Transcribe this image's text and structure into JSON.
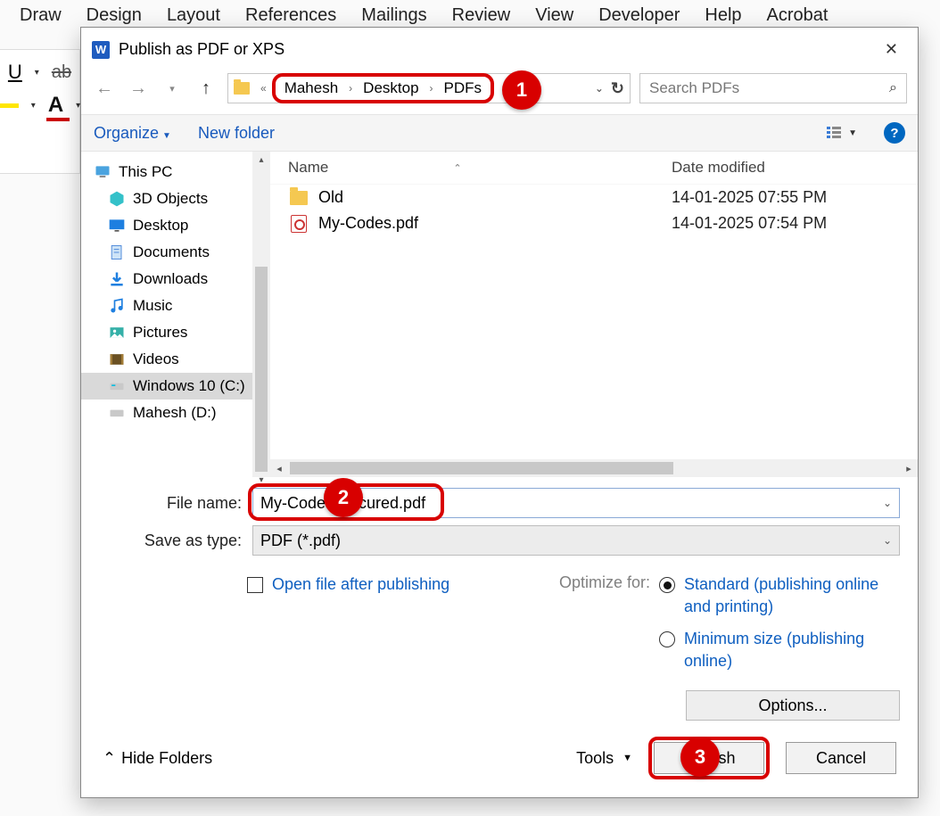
{
  "ribbon": {
    "tabs": [
      "Draw",
      "Design",
      "Layout",
      "References",
      "Mailings",
      "Review",
      "View",
      "Developer",
      "Help",
      "Acrobat"
    ]
  },
  "dialog": {
    "title": "Publish as PDF or XPS",
    "breadcrumb": [
      "Mahesh",
      "Desktop",
      "PDFs"
    ],
    "search_placeholder": "Search PDFs",
    "toolbar": {
      "organize": "Organize",
      "newfolder": "New folder"
    },
    "sidebar": [
      {
        "label": "This PC",
        "icon": "pc"
      },
      {
        "label": "3D Objects",
        "icon": "3d"
      },
      {
        "label": "Desktop",
        "icon": "desktop"
      },
      {
        "label": "Documents",
        "icon": "docs"
      },
      {
        "label": "Downloads",
        "icon": "down"
      },
      {
        "label": "Music",
        "icon": "music"
      },
      {
        "label": "Pictures",
        "icon": "pics"
      },
      {
        "label": "Videos",
        "icon": "vids"
      },
      {
        "label": "Windows 10 (C:)",
        "icon": "drive",
        "selected": true
      },
      {
        "label": "Mahesh (D:)",
        "icon": "drive"
      }
    ],
    "columns": {
      "name": "Name",
      "date": "Date modified"
    },
    "files": [
      {
        "name": "Old",
        "type": "folder",
        "date": "14-01-2025 07:55 PM"
      },
      {
        "name": "My-Codes.pdf",
        "type": "pdf",
        "date": "14-01-2025 07:54 PM"
      }
    ],
    "filename_label": "File name:",
    "filename_value": "My-Codes-Secured.pdf",
    "savetype_label": "Save as type:",
    "savetype_value": "PDF (*.pdf)",
    "open_after": "Open file after publishing",
    "optimize_label": "Optimize for:",
    "opt_standard": "Standard (publishing online and printing)",
    "opt_min": "Minimum size (publishing online)",
    "options_btn": "Options...",
    "hide_folders": "Hide Folders",
    "tools": "Tools",
    "publish": "Publish",
    "cancel": "Cancel"
  },
  "callouts": {
    "c1": "1",
    "c2": "2",
    "c3": "3"
  }
}
